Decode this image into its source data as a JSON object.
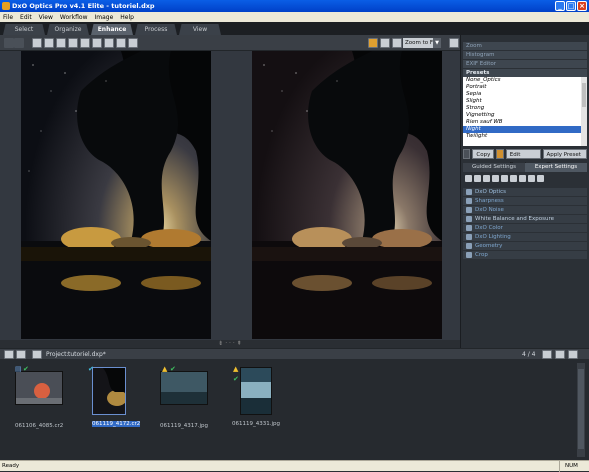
{
  "window": {
    "title": "DxO Optics Pro v4.1 Elite - tutoriel.dxp",
    "buttons": [
      "_",
      "□",
      "×"
    ]
  },
  "menu": [
    "File",
    "Edit",
    "View",
    "Workflow",
    "Image",
    "Help"
  ],
  "tabs": [
    "Select",
    "Organize",
    "Enhance",
    "Process",
    "View"
  ],
  "active_tab": "Enhance",
  "toolbar": {
    "zoom_label": "Zoom to Fit",
    "zoom_arrow": "▼"
  },
  "panel": {
    "sections_top": [
      "Zoom",
      "Histogram",
      "EXIF Editor"
    ],
    "presets_title": "Presets",
    "presets": [
      "None_Optics",
      "Portrait",
      "Sepia",
      "Slight",
      "Strong",
      "Vignetting",
      "Rien sauf WB",
      "Night",
      "Twilight"
    ],
    "selected_preset": "Night",
    "buttons": {
      "copy": "Copy",
      "edit": "Edit Preset",
      "apply": "Apply Preset",
      "apply_arrow": "▼"
    },
    "subtabs": [
      "Guided Settings",
      "Expert Settings"
    ],
    "palettes": [
      "DxO Optics",
      "Sharpness",
      "DxO Noise",
      "White Balance and Exposure",
      "DxO Color",
      "DxO Lighting",
      "Geometry",
      "Crop"
    ]
  },
  "filmstrip": {
    "project_label": "Project:",
    "project_name": "tutoriel.dxp*",
    "counter": "4 / 4",
    "thumbs": [
      {
        "name": "061106_4085.cr2",
        "selected": false
      },
      {
        "name": "061119_4172.cr2",
        "selected": true
      },
      {
        "name": "061119_4317.jpg",
        "selected": false
      },
      {
        "name": "061119_4331.jpg",
        "selected": false
      }
    ]
  },
  "splitter_glyphs": "⇟ · · · ⇞",
  "status": {
    "left": "Ready",
    "right": "NUM"
  }
}
